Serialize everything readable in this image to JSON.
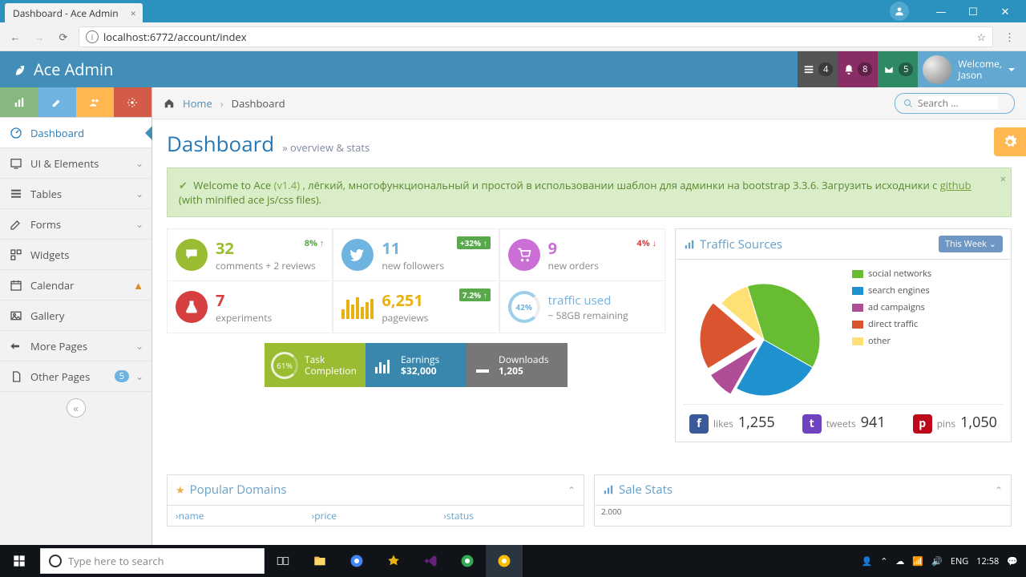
{
  "browser": {
    "tab_title": "Dashboard - Ace Admin",
    "url": "localhost:6772/account/index"
  },
  "navbar": {
    "brand": "Ace Admin",
    "notifications": {
      "tasks": "4",
      "bell": "8",
      "mail": "5"
    },
    "user": {
      "welcome": "Welcome,",
      "name": "Jason"
    }
  },
  "sidebar": {
    "items": [
      "Dashboard",
      "UI & Elements",
      "Tables",
      "Forms",
      "Widgets",
      "Calendar",
      "Gallery",
      "More Pages",
      "Other Pages"
    ],
    "other_pages_count": "5"
  },
  "breadcrumbs": {
    "home": "Home",
    "current": "Dashboard",
    "search_placeholder": "Search ..."
  },
  "page": {
    "title": "Dashboard",
    "subtitle": "overview & stats"
  },
  "alert": {
    "prefix": "Welcome to Ace ",
    "version": "(v1.4)",
    "middle": " , лёгкий, многофункциональный и простой в использовании шаблон для админки на bootstrap 3.3.6. Загрузить исходники с ",
    "link": "github",
    "suffix": " (with minified ace js/css files)."
  },
  "infoboxes": {
    "comments": {
      "value": "32",
      "label": "comments + 2 reviews",
      "stat": "8%"
    },
    "followers": {
      "value": "11",
      "label": "new followers",
      "stat": "+32%"
    },
    "orders": {
      "value": "9",
      "label": "new orders",
      "stat": "4%"
    },
    "experiments": {
      "value": "7",
      "label": "experiments"
    },
    "pageviews": {
      "value": "6,251",
      "label": "pageviews",
      "stat": "7.2%"
    },
    "traffic": {
      "pct": "42%",
      "label": "traffic used",
      "sub": "~ 58GB remaining"
    }
  },
  "tiles": {
    "task": {
      "pct": "61%",
      "l1": "Task",
      "l2": "Completion"
    },
    "earnings": {
      "l1": "Earnings",
      "val": "$32,000"
    },
    "downloads": {
      "l1": "Downloads",
      "val": "1,205"
    }
  },
  "traffic_widget": {
    "title": "Traffic Sources",
    "btn": "This Week",
    "legend": [
      "social networks",
      "search engines",
      "ad campaigns",
      "direct traffic",
      "other"
    ],
    "socials": {
      "likes_l": "likes",
      "likes": "1,255",
      "tweets_l": "tweets",
      "tweets": "941",
      "pins_l": "pins",
      "pins": "1,050"
    }
  },
  "chart_data": {
    "type": "pie",
    "title": "Traffic Sources",
    "series": [
      {
        "name": "social networks",
        "value": 38,
        "color": "#68bc31"
      },
      {
        "name": "search engines",
        "value": 25,
        "color": "#2091cf"
      },
      {
        "name": "ad campaigns",
        "value": 8,
        "color": "#af4e96"
      },
      {
        "name": "direct traffic",
        "value": 20,
        "color": "#da5430"
      },
      {
        "name": "other",
        "value": 9,
        "color": "#fee074"
      }
    ]
  },
  "popular_domains": {
    "title": "Popular Domains",
    "cols": [
      "name",
      "price",
      "status"
    ]
  },
  "sale_stats": {
    "title": "Sale Stats",
    "ymax": "2.000"
  },
  "taskbar": {
    "search_placeholder": "Type here to search",
    "lang": "ENG",
    "time": "12:58"
  }
}
